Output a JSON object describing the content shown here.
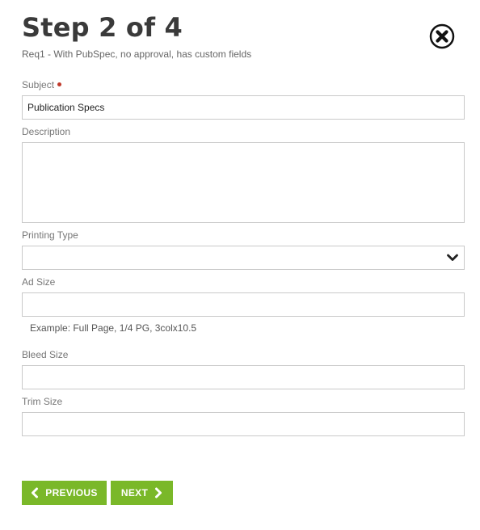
{
  "header": {
    "title": "Step 2 of 4",
    "subtitle": "Req1 - With PubSpec, no approval, has custom fields"
  },
  "form": {
    "subject": {
      "label": "Subject",
      "required": true,
      "value": "Publication Specs"
    },
    "description": {
      "label": "Description",
      "value": ""
    },
    "printing_type": {
      "label": "Printing Type",
      "selected": ""
    },
    "ad_size": {
      "label": "Ad Size",
      "value": "",
      "hint": "Example: Full Page, 1/4 PG, 3colx10.5"
    },
    "bleed_size": {
      "label": "Bleed Size",
      "value": ""
    },
    "trim_size": {
      "label": "Trim Size",
      "value": ""
    }
  },
  "footer": {
    "previous_label": "PREVIOUS",
    "next_label": "NEXT"
  },
  "colors": {
    "accent_green": "#7ab829",
    "required_dot": "#c0392b",
    "input_border": "#c9c9c9"
  },
  "icons": {
    "close": "close-circle-icon",
    "select_toggle": "chevron-down-icon",
    "previous": "chevron-left-icon",
    "next": "chevron-right-icon"
  }
}
